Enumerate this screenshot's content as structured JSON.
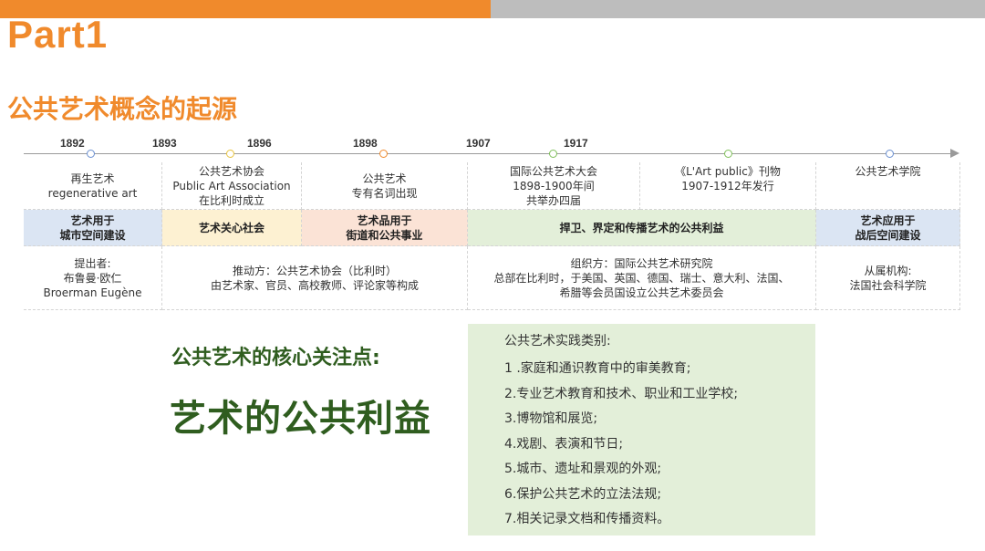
{
  "header": {
    "part": "Part1",
    "section_title": "公共艺术概念的起源"
  },
  "timeline": {
    "years": [
      "1892",
      "1893",
      "1896",
      "1898",
      "1907",
      "1917"
    ],
    "colors": {
      "blue": "#6a8fd0",
      "yellow": "#e8c440",
      "orange": "#f08a2c",
      "green": "#7fbf5a"
    }
  },
  "events": [
    {
      "lines": [
        "再生艺术",
        "regenerative art"
      ]
    },
    {
      "lines": [
        "公共艺术协会",
        "Public Art Association",
        "在比利时成立"
      ]
    },
    {
      "lines": [
        "公共艺术",
        "专有名词出现"
      ]
    },
    {
      "lines": [
        "国际公共艺术大会",
        "1898-1900年间",
        "共举办四届"
      ]
    },
    {
      "lines": [
        "《L'Art public》刊物",
        "1907-1912年发行"
      ]
    },
    {
      "lines": [
        "公共艺术学院"
      ]
    }
  ],
  "themes": [
    {
      "lines": [
        "艺术用于",
        "城市空间建设"
      ],
      "color": "#dbe5f3"
    },
    {
      "lines": [
        "艺术关心社会"
      ],
      "color": "#fdf1d2"
    },
    {
      "lines": [
        "艺术品用于",
        "街道和公共事业"
      ],
      "color": "#fbe3d6"
    },
    {
      "lines": [
        "捍卫、界定和传播艺术的公共利益"
      ],
      "color": "#e3efd9"
    },
    {
      "lines": [
        "艺术应用于",
        "战后空间建设"
      ],
      "color": "#dbe5f3"
    }
  ],
  "details": [
    {
      "lines": [
        "提出者:",
        "布鲁曼·欧仁",
        "Broerman Eugène"
      ]
    },
    {
      "lines": [
        "推动方：公共艺术协会（比利时）",
        "由艺术家、官员、高校教师、评论家等构成"
      ]
    },
    {
      "lines": [
        "组织方：国际公共艺术研究院",
        "总部在比利时，于美国、英国、德国、瑞士、意大利、法国、",
        "希腊等会员国设立公共艺术委员会"
      ]
    },
    {
      "lines": [
        "从属机构:",
        "法国社会科学院"
      ]
    }
  ],
  "focus": {
    "label": "公共艺术的核心关注点:",
    "main": "艺术的公共利益"
  },
  "practice": {
    "title": "公共艺术实践类别:",
    "items": [
      "1 .家庭和通识教育中的审美教育;",
      "2.专业艺术教育和技术、职业和工业学校;",
      "3.博物馆和展览;",
      "4.戏剧、表演和节日;",
      "5.城市、遗址和景观的外观;",
      "6.保护公共艺术的立法法规;",
      "7.相关记录文档和传播资料。"
    ]
  }
}
